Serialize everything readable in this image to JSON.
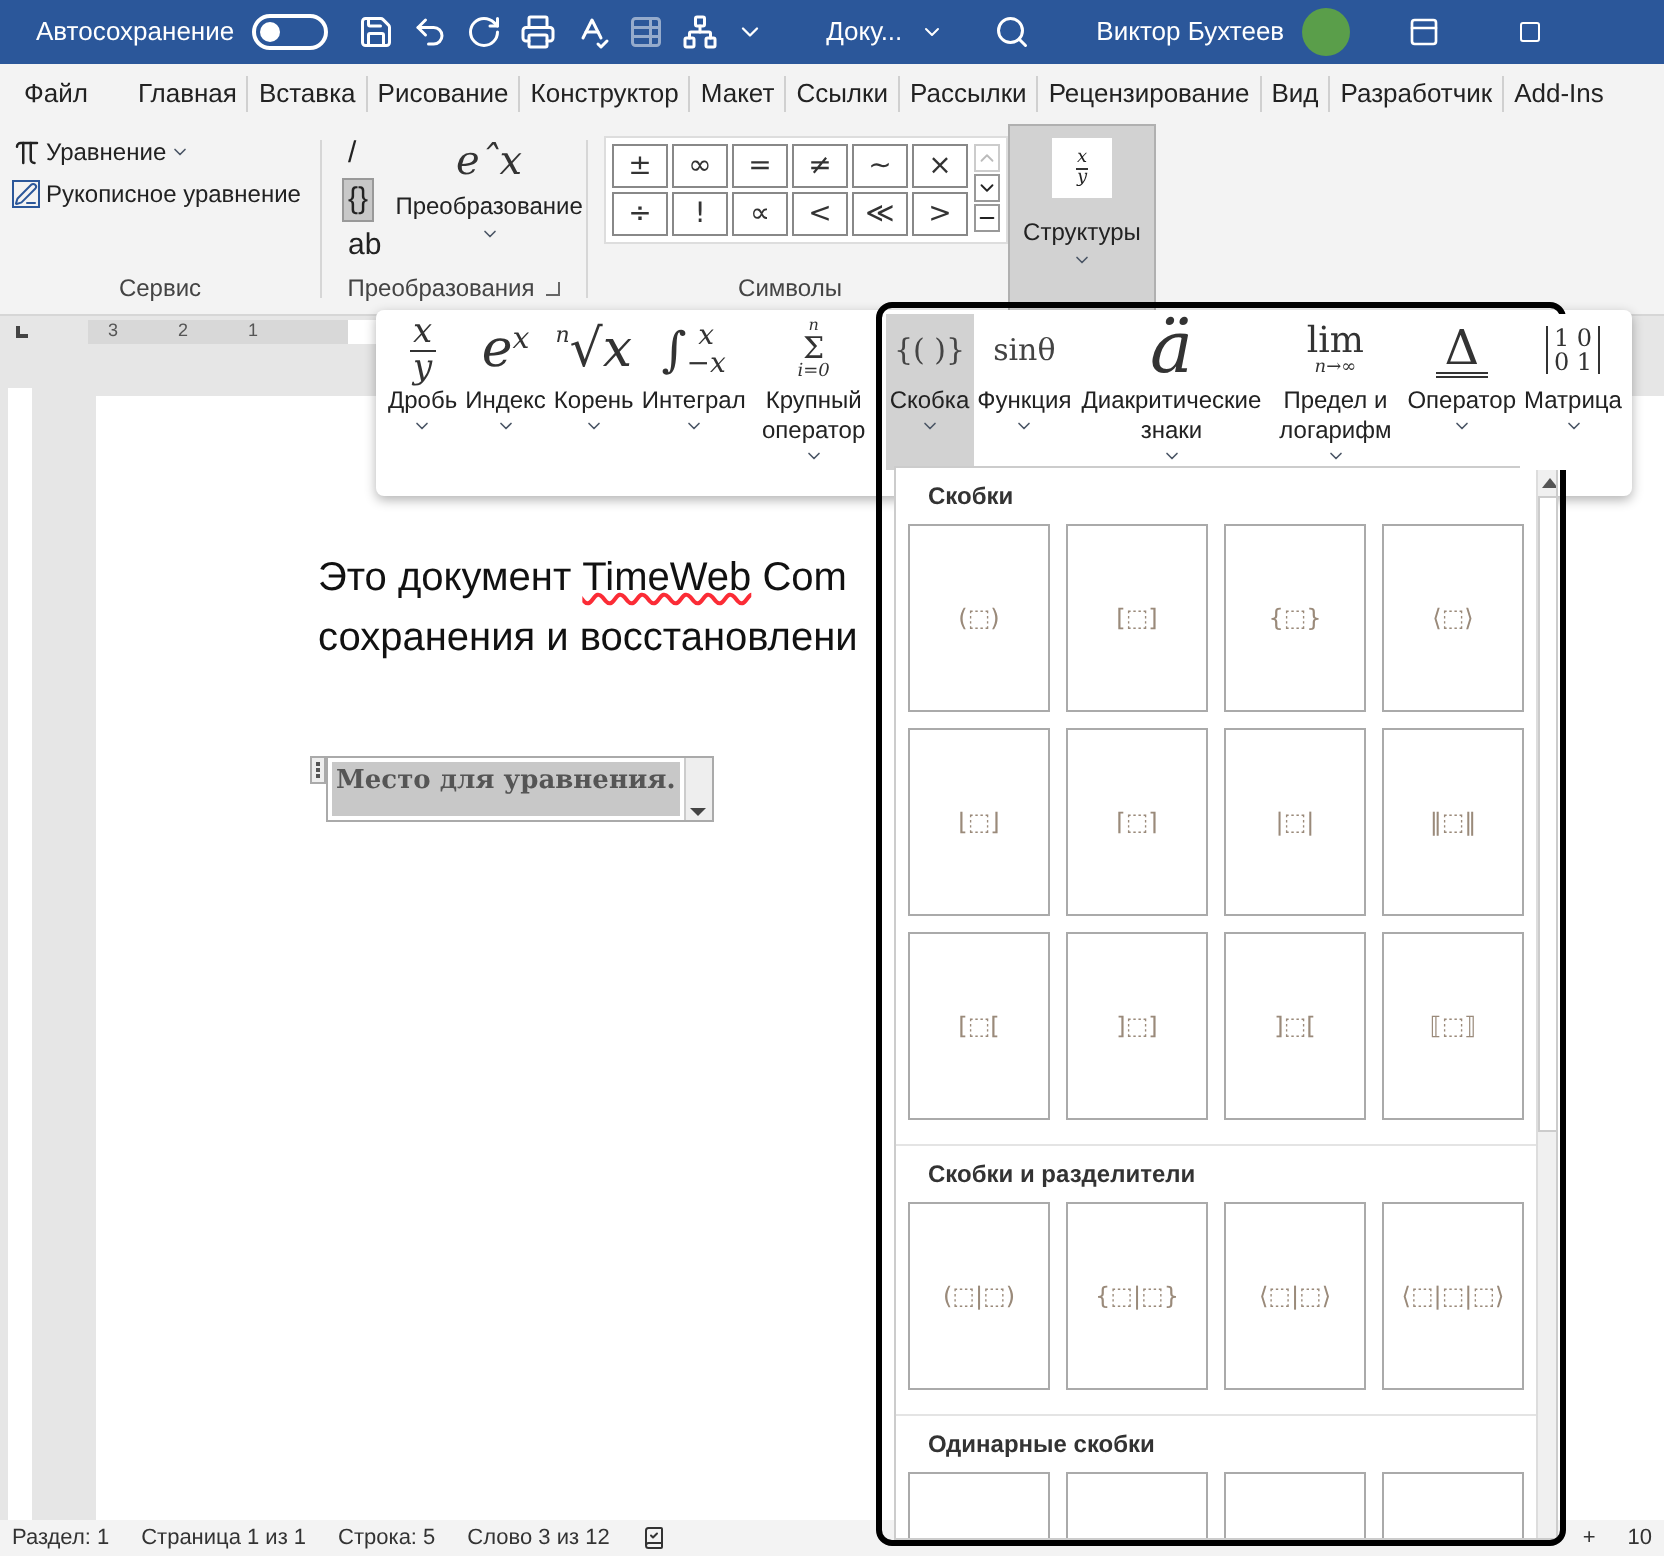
{
  "title_bar": {
    "autosave_label": "Автосохранение",
    "autosave_on": false,
    "document_name": "Доку...",
    "user_name": "Виктор Бухтеев"
  },
  "menu_tabs": [
    "Файл",
    "Главная",
    "Вставка",
    "Рисование",
    "Конструктор",
    "Макет",
    "Ссылки",
    "Рассылки",
    "Рецензирование",
    "Вид",
    "Разработчик",
    "Add-Ins"
  ],
  "ribbon": {
    "service": {
      "equation_button": "Уравнение",
      "ink_equation_button": "Рукописное уравнение",
      "group_label": "Сервис"
    },
    "conversions": {
      "format_buttons": [
        {
          "label": "/",
          "selected": false
        },
        {
          "label": "{}",
          "selected": true
        },
        {
          "label": "ab",
          "selected": false
        }
      ],
      "convert_symbol": "eˆx",
      "convert_button": "Преобразование",
      "group_label": "Преобразования"
    },
    "symbols": {
      "items": [
        "±",
        "∞",
        "=",
        "≠",
        "~",
        "×",
        "÷",
        "!",
        "∝",
        "<",
        "≪",
        ">"
      ],
      "group_label": "Символы"
    },
    "structures_button": {
      "label": "Структуры",
      "top": "x",
      "bottom": "y",
      "pressed": true
    }
  },
  "structures": [
    {
      "label": "Дробь",
      "selected": false,
      "symbol": {
        "kind": "fraction",
        "top": "x",
        "bottom": "y"
      }
    },
    {
      "label": "Индекс",
      "selected": false,
      "symbol": {
        "kind": "script",
        "base": "e",
        "sup": "x"
      }
    },
    {
      "label": "Корень",
      "selected": false,
      "symbol": {
        "kind": "script",
        "pre": "n",
        "base": "√x"
      }
    },
    {
      "label": "Интеграл",
      "selected": false,
      "symbol": {
        "kind": "limits",
        "base": "∫",
        "sup": "x",
        "sub": "−x"
      }
    },
    {
      "label": "Крупный оператор",
      "selected": false,
      "symbol": {
        "kind": "stack",
        "top": "n",
        "base": "Σ",
        "bottom": "i=0"
      }
    },
    {
      "label": "Скобка",
      "selected": true,
      "symbol": {
        "kind": "plain",
        "base": "{( )}"
      }
    },
    {
      "label": "Функция",
      "selected": false,
      "symbol": {
        "kind": "plain",
        "base": "sinθ"
      }
    },
    {
      "label": "Диакритические знаки",
      "selected": false,
      "symbol": {
        "kind": "big",
        "base": "ä"
      }
    },
    {
      "label": "Предел и логарифм",
      "selected": false,
      "symbol": {
        "kind": "stack",
        "base": "lim",
        "bottom": "n→∞"
      }
    },
    {
      "label": "Оператор",
      "selected": false,
      "symbol": {
        "kind": "underbar",
        "base": "Δ"
      }
    },
    {
      "label": "Матрица",
      "selected": false,
      "symbol": {
        "kind": "matrix",
        "rows": [
          "1 0",
          "0 1"
        ]
      }
    }
  ],
  "gallery": {
    "sections": [
      {
        "title": "Скобки",
        "items": [
          "(⬚)",
          "[⬚]",
          "{⬚}",
          "⟨⬚⟩",
          "⌊⬚⌋",
          "⌈⬚⌉",
          "|⬚|",
          "‖⬚‖",
          "[⬚[",
          "]⬚]",
          "]⬚[",
          "⟦⬚⟧"
        ]
      },
      {
        "title": "Скобки и разделители",
        "items": [
          "(⬚|⬚)",
          "{⬚|⬚}",
          "⟨⬚|⬚⟩",
          "⟨⬚|⬚|⬚⟩"
        ]
      },
      {
        "title": "Одинарные скобки",
        "cut_off": true
      }
    ]
  },
  "document": {
    "lines": [
      {
        "before": "Это документ ",
        "misspelled": "TimeWeb",
        "after": " Com"
      },
      {
        "before": "сохранения и восстановлени"
      }
    ],
    "equation_placeholder": "Место для уравнения."
  },
  "ruler_numbers": [
    "3",
    "2",
    "1"
  ],
  "status_bar": {
    "items": [
      "Раздел: 1",
      "Страница 1 из 1",
      "Строка: 5",
      "Слово 3 из 12"
    ],
    "zoom_plus": "+",
    "zoom": "10"
  }
}
